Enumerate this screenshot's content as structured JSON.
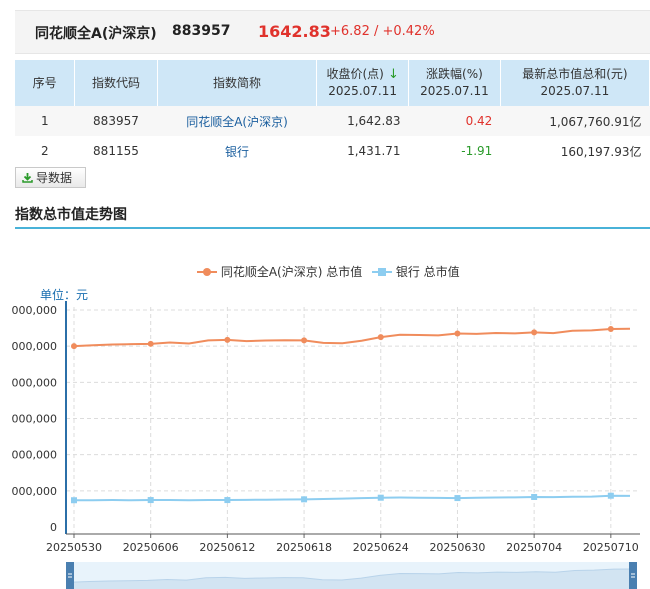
{
  "header": {
    "name": "同花顺全A(沪深京)",
    "code": "883957",
    "price": "1642.83",
    "change": "+6.82 / +0.42%"
  },
  "table": {
    "columns": [
      {
        "label": "序号"
      },
      {
        "label": "指数代码"
      },
      {
        "label": "指数简称"
      },
      {
        "label": "收盘价(点)",
        "date": "2025.07.11",
        "sort_icon": "down-arrow-icon"
      },
      {
        "label": "涨跌幅(%)",
        "date": "2025.07.11"
      },
      {
        "label": "最新总市值总和(元)",
        "date": "2025.07.11"
      }
    ],
    "rows": [
      {
        "no": "1",
        "code": "883957",
        "name": "同花顺全A(沪深京)",
        "close": "1,642.83",
        "pct": "0.42",
        "cap": "1,067,760.91亿"
      },
      {
        "no": "2",
        "code": "881155",
        "name": "银行",
        "close": "1,431.71",
        "pct": "-1.91",
        "cap": "160,197.93亿"
      }
    ]
  },
  "export_label": "导数据",
  "section_title": "指数总市值走势图",
  "chart_data": {
    "type": "line",
    "unit_label": "单位：元",
    "y_tick_labels": [
      "0",
      "000,000",
      "000,000",
      "000,000",
      "000,000",
      "000,000",
      "000,000"
    ],
    "ylim": [
      0,
      1200000
    ],
    "x_tick_labels": [
      "20250530",
      "20250606",
      "20250612",
      "20250618",
      "20250624",
      "20250630",
      "20250704",
      "20250710"
    ],
    "x": [
      "20250530",
      "20250603",
      "20250604",
      "20250605",
      "20250606",
      "20250609",
      "20250610",
      "20250611",
      "20250612",
      "20250613",
      "20250616",
      "20250617",
      "20250618",
      "20250619",
      "20250620",
      "20250623",
      "20250624",
      "20250625",
      "20250626",
      "20250627",
      "20250630",
      "20250701",
      "20250702",
      "20250703",
      "20250704",
      "20250707",
      "20250708",
      "20250709",
      "20250710",
      "20250711"
    ],
    "grid": true,
    "legend_position": "top-center",
    "series": [
      {
        "name": "同花顺全A(沪深京) 总市值",
        "color": "#f08c5c",
        "marker": "circle",
        "values": [
          1000000,
          1005000,
          1009000,
          1011000,
          1013000,
          1020000,
          1015000,
          1032000,
          1035000,
          1028000,
          1031000,
          1033000,
          1032000,
          1018000,
          1016000,
          1030000,
          1050000,
          1063000,
          1062000,
          1060000,
          1070000,
          1068000,
          1073000,
          1071000,
          1076000,
          1072000,
          1085000,
          1087000,
          1095000,
          1096000
        ]
      },
      {
        "name": "银行 总市值",
        "color": "#8dcdf0",
        "marker": "square",
        "values": [
          148000,
          148000,
          149000,
          148000,
          149000,
          149000,
          148000,
          149000,
          149000,
          150000,
          151000,
          152000,
          153000,
          155000,
          157000,
          160000,
          162000,
          163000,
          162000,
          161000,
          160000,
          162000,
          163000,
          164000,
          166000,
          165000,
          167000,
          168000,
          173000,
          172000
        ]
      }
    ]
  }
}
